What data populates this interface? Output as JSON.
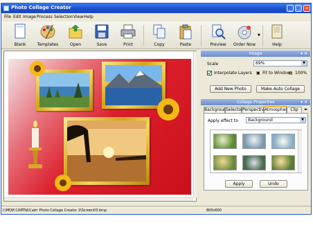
{
  "app": {
    "title": "Photo Collage Creator"
  },
  "menu": [
    "File",
    "Edit",
    "Image",
    "Process",
    "Selection",
    "View",
    "Help"
  ],
  "toolbar": {
    "blank": "Blank",
    "templates": "Templates",
    "open": "Open",
    "save": "Save",
    "print": "Print",
    "copy": "Copy",
    "paste": "Paste",
    "preview": "Preview",
    "order_now": "Order Now",
    "help": "Help"
  },
  "image_panel": {
    "header": "Image",
    "scale_label": "Scale",
    "scale_value": "69%",
    "interpolate_label": "Interpolate Layers",
    "interpolate_checked": true,
    "fit_label": "Fit to Window",
    "hundred_label": "100%",
    "add_photo": "Add New Photo",
    "auto_collage": "Make Auto Collage"
  },
  "properties_panel": {
    "header": "Collage Properties",
    "tabs": [
      "Background",
      "Selector",
      "Perspective",
      "Atmosphere",
      "Clip Art"
    ],
    "active_tab": "Atmosphere",
    "apply_label": "Apply effect to",
    "apply_value": "Background",
    "apply_button": "Apply",
    "undo_button": "Undo"
  },
  "status": {
    "path": "I:\\МОИ САЙТЫ\\Сайт Photo Collage Creator 2\\Screen03.bmp",
    "size": "800x600"
  }
}
